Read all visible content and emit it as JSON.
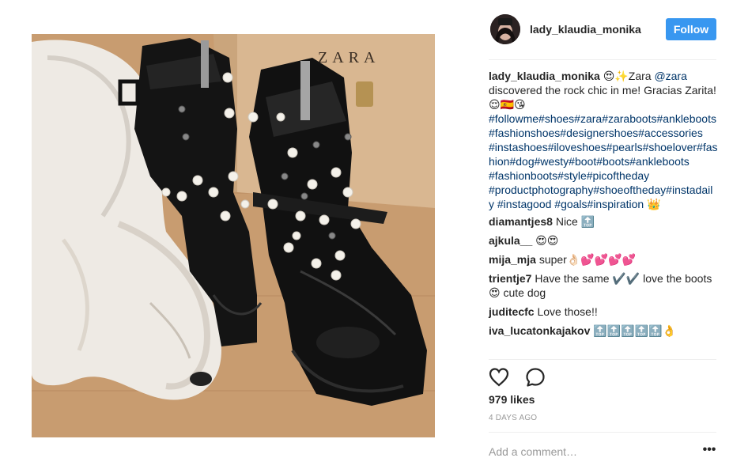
{
  "post": {
    "image_alt": "black leather combat boots with pearl studs next to a sleeping white dog and a ZARA box",
    "box_brand": "ZARA"
  },
  "header": {
    "username": "lady_klaudia_monika",
    "follow_label": "Follow"
  },
  "caption": {
    "username": "lady_klaudia_monika",
    "pre": "😍✨Zara ",
    "mention": "@zara",
    "text": " discovered the rock chic in me! Gracias Zarita! 😌🇪🇸😘",
    "hashtags_1": "#followme#shoes#zara#zaraboots#ankleboots#fashionshoes#designershoes#accessories",
    "hashtags_2": "#instashoes#iloveshoes#pearls#shoelover#fashion#dog#westy#boot#boots#ankleboots #fashionboots#style#picoftheday #productphotography#shoeoftheday#instadaily #instagood #goals#inspiration",
    "end_emoji": " 👑"
  },
  "comments": [
    {
      "user": "diamantjes8",
      "text": " Nice 🔝"
    },
    {
      "user": "ajkula__",
      "text": "  😍😍"
    },
    {
      "user": "mija_mja",
      "text": " super👌🏻💕💕💕💕"
    },
    {
      "user": "trientje7",
      "text": " Have the same ✔️✔️ love the boots 😍 cute dog"
    },
    {
      "user": "juditecfc",
      "text": " Love those!!"
    },
    {
      "user": "iva_lucatonkajakov",
      "text": " 🔝🔝🔝🔝🔝👌"
    }
  ],
  "actions": {
    "like_icon": "heart-icon",
    "comment_icon": "comment-bubble-icon"
  },
  "likes": "979 likes",
  "timestamp": "4 DAYS AGO",
  "comment_input": {
    "placeholder": "Add a comment…",
    "value": ""
  },
  "more_options_label": "•••",
  "colors": {
    "follow_button": "#3897f0",
    "hashtag": "#003569",
    "muted": "#999999",
    "divider": "#efefef"
  }
}
